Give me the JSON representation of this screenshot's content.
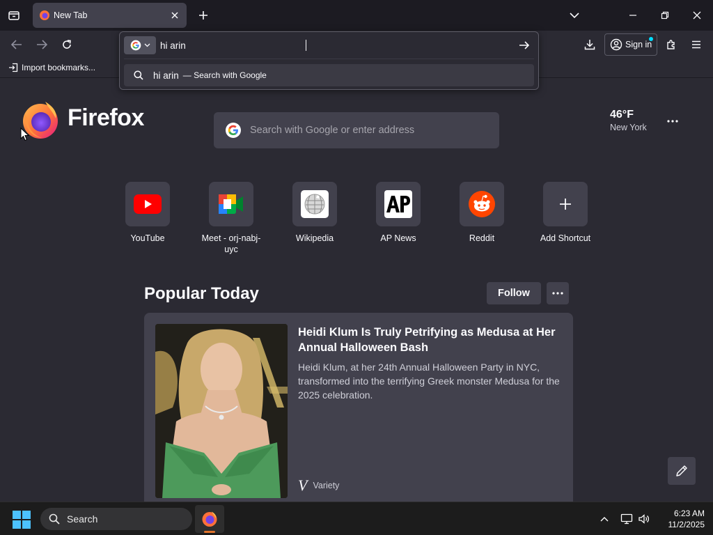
{
  "tab": {
    "title": "New Tab"
  },
  "navbar": {
    "signin_label": "Sign in"
  },
  "bookmarks": {
    "import_label": "Import bookmarks..."
  },
  "urlbar": {
    "value": "hi arin",
    "suggestion_text": "hi arin",
    "suggestion_action": "— Search with Google"
  },
  "newtab": {
    "wordmark": "Firefox",
    "search_placeholder": "Search with Google or enter address",
    "weather": {
      "temp": "46°F",
      "location": "New York"
    },
    "shortcuts": [
      {
        "label": "YouTube",
        "icon": "youtube-icon"
      },
      {
        "label": "Meet - orj-nabj-uyc",
        "icon": "google-meet-icon"
      },
      {
        "label": "Wikipedia",
        "icon": "wikipedia-icon"
      },
      {
        "label": "AP News",
        "icon": "ap-news-icon"
      },
      {
        "label": "Reddit",
        "icon": "reddit-icon"
      },
      {
        "label": "Add Shortcut",
        "icon": "plus-icon"
      }
    ],
    "section_title": "Popular Today",
    "follow_label": "Follow",
    "story": {
      "title": "Heidi Klum Is Truly Petrifying as Medusa at Her Annual Halloween Bash",
      "excerpt": "Heidi Klum, at her 24th Annual Halloween Party in NYC, transformed into the terrifying Greek monster Medusa for the 2025 celebration.",
      "source": "Variety",
      "source_logo": "V"
    }
  },
  "taskbar": {
    "search_label": "Search",
    "time": "6:23 AM",
    "date": "11/2/2025"
  },
  "colors": {
    "chrome_dark": "#1c1b22",
    "page_bg": "#2b2a33",
    "surface": "#42414d",
    "text": "#fbfbfe",
    "accent_blue": "#00ddff"
  }
}
